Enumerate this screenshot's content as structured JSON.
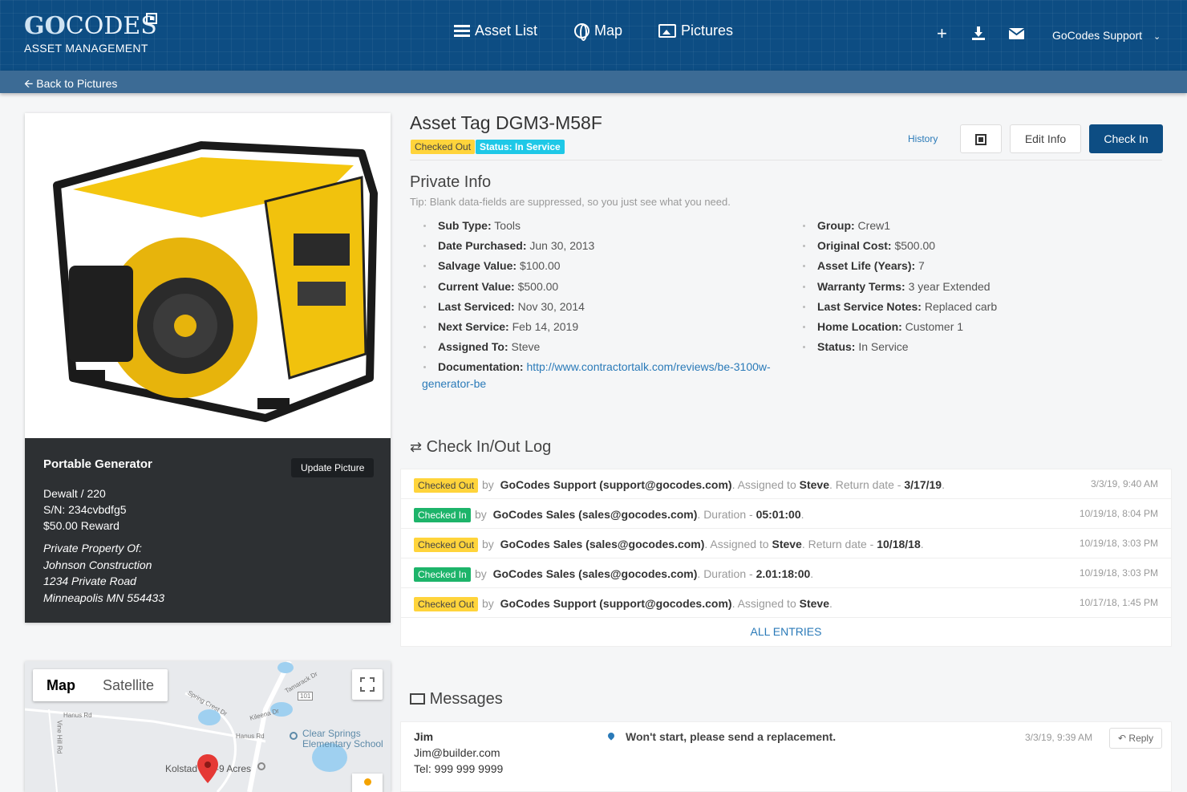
{
  "header": {
    "logo_go": "GO",
    "logo_codes": "CODES",
    "logo_sub": "ASSET MANAGEMENT",
    "nav": [
      {
        "label": "Asset List",
        "icon": "list-icon"
      },
      {
        "label": "Map",
        "icon": "globe-icon"
      },
      {
        "label": "Pictures",
        "icon": "pictures-icon"
      }
    ],
    "user": "GoCodes Support",
    "actions": [
      "plus-icon",
      "download-icon",
      "envelope-icon"
    ]
  },
  "subbar": {
    "back_label": "Back to Pictures"
  },
  "asset": {
    "title": "Asset Tag DGM3-M58F",
    "badges": [
      "Checked Out",
      "Status: In Service"
    ],
    "history": "History",
    "edit": "Edit Info",
    "checkin": "Check In"
  },
  "card": {
    "name": "Portable Generator",
    "update_btn": "Update Picture",
    "lines": [
      "Dewalt / 220",
      "S/N: 234cvbdfg5",
      "$50.00 Reward"
    ],
    "property": [
      "Private Property Of:",
      "Johnson Construction",
      "1234 Private Road",
      "Minneapolis MN 554433"
    ]
  },
  "map": {
    "tab_map": "Map",
    "tab_satellite": "Satellite",
    "labels": {
      "school": "Clear Springs",
      "school2": "Elementary School",
      "place": "Kolstad",
      "place2": "-9 Acres",
      "hwy": "101",
      "road1": "Hanus Rd",
      "road2": "Hanus Rd",
      "road3": "Spring Crest Dr",
      "road4": "Kileena Dr",
      "road5": "Tamarack Dr",
      "road6": "Vine Hill Rd"
    }
  },
  "private_info": {
    "title": "Private Info",
    "tip": "Tip: Blank data-fields are suppressed, so you just see what you need.",
    "left": [
      {
        "k": "Sub Type:",
        "v": " Tools"
      },
      {
        "k": "Date Purchased:",
        "v": " Jun 30, 2013"
      },
      {
        "k": "Salvage Value:",
        "v": " $100.00"
      },
      {
        "k": "Current Value:",
        "v": " $500.00"
      },
      {
        "k": "Last Serviced:",
        "v": " Nov 30, 2014"
      },
      {
        "k": "Next Service:",
        "v": " Feb 14, 2019"
      },
      {
        "k": "Assigned To:",
        "v": " Steve"
      },
      {
        "k": "Documentation:",
        "v": " http://www.contractortalk.com/reviews/be-3100w-",
        "v2": "generator-be"
      }
    ],
    "right": [
      {
        "k": "Group:",
        "v": " Crew1"
      },
      {
        "k": "Original Cost:",
        "v": " $500.00"
      },
      {
        "k": "Asset Life (Years):",
        "v": " 7"
      },
      {
        "k": "Warranty Terms:",
        "v": " 3 year Extended"
      },
      {
        "k": "Last Service Notes:",
        "v": " Replaced carb"
      },
      {
        "k": "Home Location:",
        "v": " Customer 1"
      },
      {
        "k": "Status:",
        "v": " In Service"
      }
    ]
  },
  "log": {
    "title": "Check In/Out Log",
    "rows": [
      {
        "badge": "Checked Out",
        "by": "by",
        "who": "GoCodes Support (support@gocodes.com)",
        "p1": ".  Assigned to ",
        "b1": "Steve",
        "p2": ".  Return date - ",
        "b2": "3/17/19",
        "p3": ".",
        "time": "3/3/19, 9:40 AM"
      },
      {
        "badge": "Checked In",
        "by": "by",
        "who": "GoCodes Sales (sales@gocodes.com)",
        "p1": ".  Duration - ",
        "b1": "05:01:00",
        "p2": ".",
        "b2": "",
        "p3": "",
        "time": "10/19/18, 8:04 PM"
      },
      {
        "badge": "Checked Out",
        "by": "by",
        "who": "GoCodes Sales (sales@gocodes.com)",
        "p1": ".  Assigned to ",
        "b1": "Steve",
        "p2": ".  Return date - ",
        "b2": "10/18/18",
        "p3": ".",
        "time": "10/19/18, 3:03 PM"
      },
      {
        "badge": "Checked In",
        "by": "by",
        "who": "GoCodes Sales (sales@gocodes.com)",
        "p1": ".  Duration - ",
        "b1": "2.01:18:00",
        "p2": ".",
        "b2": "",
        "p3": "",
        "time": "10/19/18, 3:03 PM"
      },
      {
        "badge": "Checked Out",
        "by": "by",
        "who": "GoCodes Support (support@gocodes.com)",
        "p1": ".  Assigned to ",
        "b1": "Steve",
        "p2": ".",
        "b2": "",
        "p3": "",
        "time": "10/17/18, 1:45 PM"
      }
    ],
    "all_entries": "ALL ENTRIES"
  },
  "messages": {
    "title": "Messages",
    "items": [
      {
        "name": "Jim",
        "email": "Jim@builder.com",
        "tel": "Tel: 999 999 9999",
        "text": "Won't start, please send a replacement.",
        "time": "3/3/19, 9:39 AM",
        "reply": "Reply"
      }
    ]
  },
  "colors": {
    "brand": "#0d4d83",
    "checked_out": "#ffd43b",
    "checked_in": "#1db46a",
    "status": "#1ec8e7"
  }
}
